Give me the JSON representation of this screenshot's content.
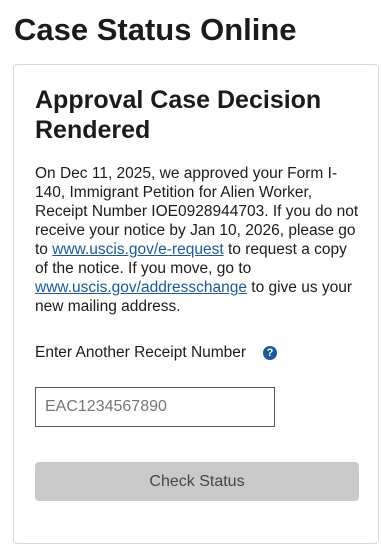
{
  "page": {
    "title": "Case Status Online"
  },
  "case": {
    "heading": "Approval Case Decision Rendered",
    "body": {
      "text_1": "On Dec 11, 2025, we approved your Form I-140, Immigrant Petition for Alien Worker, Receipt Number IOE0928944703. If you do not receive your notice by Jan 10, 2026, please go to ",
      "link_1": "www.uscis.gov/e-request",
      "text_2": " to request a copy of the notice. If you move, go to ",
      "link_2": "www.uscis.gov/addresschange",
      "text_3": " to give us your new mailing address."
    }
  },
  "form": {
    "receipt_label": "Enter Another Receipt Number",
    "help_icon": "question-circle-icon",
    "help_glyph": "?",
    "receipt_placeholder": "EAC1234567890",
    "receipt_value": "",
    "submit_label": "Check Status"
  },
  "colors": {
    "link": "#1a5a9a",
    "help_icon_bg": "#1a5a9a",
    "button_bg": "#c9c9c9",
    "button_text": "#454545",
    "text": "#1b1b1b"
  }
}
